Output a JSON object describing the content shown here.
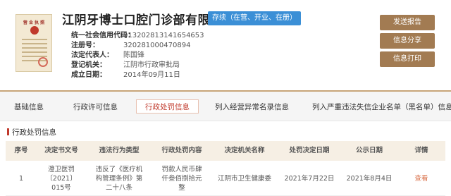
{
  "company": {
    "name": "江阴牙博士口腔门诊部有限公司",
    "status": "存续（在营、开业、在册）"
  },
  "license_image": {
    "title": "营 业 执 照"
  },
  "info": [
    {
      "key": "统一社会信用代码：",
      "value": "913202813141654653"
    },
    {
      "key": "注册号：",
      "value": "320281000470894"
    },
    {
      "key": "法定代表人：",
      "value": "陈国锋"
    },
    {
      "key": "登记机关：",
      "value": "江阴市行政审批局"
    },
    {
      "key": "成立日期：",
      "value": "2014年09月11日"
    }
  ],
  "actions": {
    "report": "发送报告",
    "share": "信息分享",
    "print": "信息打印"
  },
  "tabs": [
    "基础信息",
    "行政许可信息",
    "行政处罚信息",
    "列入经营异常名录信息",
    "列入严重违法失信企业名单（黑名单）信息"
  ],
  "section": {
    "title": "行政处罚信息",
    "columns": [
      "序号",
      "决定书文号",
      "违法行为类型",
      "行政处罚内容",
      "决定机关名称",
      "处罚决定日期",
      "公示日期",
      "详情"
    ],
    "rows": [
      {
        "index": "1",
        "doc_no": "澄卫医罚〔2021〕015号",
        "violation": "违反了《医疗机构管理条例》第二十八条",
        "penalty": "罚款人民币肆仟叁佰捌拾元整",
        "authority": "江阴市卫生健康委",
        "decision_date": "2021年7月22日",
        "publish_date": "2021年8月4日",
        "detail": "查看"
      }
    ]
  },
  "colors": {
    "accent_brown": "#a27b52",
    "active_red": "#c0392b",
    "badge_blue": "#3b8fd6",
    "table_header_bg": "#f6efe4"
  }
}
